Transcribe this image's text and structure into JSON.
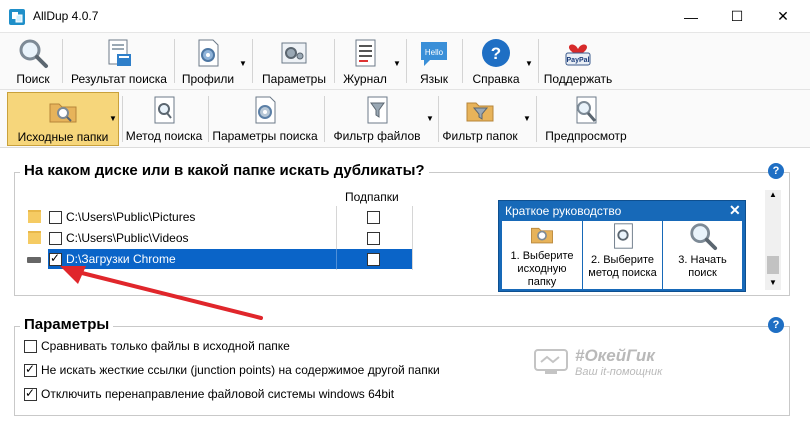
{
  "window": {
    "title": "AllDup 4.0.7",
    "controls": {
      "minimize": "—",
      "maximize": "☐",
      "close": "✕"
    }
  },
  "toolbar1": {
    "items": [
      {
        "label": "Поиск",
        "icon": "magnifier-icon"
      },
      {
        "label": "Результат поиска",
        "icon": "results-icon"
      },
      {
        "label": "Профили",
        "icon": "profiles-icon"
      },
      {
        "label": "Параметры",
        "icon": "settings-icon"
      },
      {
        "label": "Журнал",
        "icon": "log-icon"
      },
      {
        "label": "Язык",
        "icon": "language-icon",
        "badge": "Hello"
      },
      {
        "label": "Справка",
        "icon": "help-icon"
      },
      {
        "label": "Поддержать",
        "icon": "paypal-icon",
        "badge": "PayPal"
      }
    ]
  },
  "toolbar2": {
    "items": [
      {
        "label": "Исходные папки",
        "icon": "source-folders-icon",
        "active": true
      },
      {
        "label": "Метод поиска",
        "icon": "search-method-icon"
      },
      {
        "label": "Параметры поиска",
        "icon": "search-params-icon"
      },
      {
        "label": "Фильтр файлов",
        "icon": "file-filter-icon"
      },
      {
        "label": "Фильтр папок",
        "icon": "folder-filter-icon"
      },
      {
        "label": "Предпросмотр",
        "icon": "preview-icon"
      }
    ]
  },
  "folders_section": {
    "title": "На каком диске или в какой папке искать дубликаты?",
    "col_subfolders": "Подпапки",
    "rows": [
      {
        "path": "C:\\Users\\Public\\Pictures",
        "checked": false,
        "subfolders": false,
        "type": "folder"
      },
      {
        "path": "C:\\Users\\Public\\Videos",
        "checked": false,
        "subfolders": false,
        "type": "folder"
      },
      {
        "path": "D:\\Загрузки Chrome",
        "checked": true,
        "subfolders": false,
        "type": "drive",
        "selected": true
      }
    ]
  },
  "quick_guide": {
    "title": "Краткое руководство",
    "steps": [
      {
        "label": "1. Выберите исходную папку"
      },
      {
        "label": "2. Выберите метод поиска"
      },
      {
        "label": "3. Начать поиск"
      }
    ]
  },
  "params_section": {
    "title": "Параметры",
    "options": [
      {
        "label": "Сравнивать только файлы в исходной папке",
        "checked": false
      },
      {
        "label": "Не искать жесткие ссылки (junction points) на содержимое другой папки",
        "checked": true
      },
      {
        "label": "Отключить перенаправление файловой системы windows 64bit",
        "checked": true
      }
    ]
  },
  "watermark": {
    "brand": "#ОкейГик",
    "tagline": "Ваш it-помощник"
  },
  "help_glyph": "?",
  "colors": {
    "selection": "#0a64c8",
    "guide": "#1769b8",
    "active_tab": "#f6d67b",
    "arrow": "#e0262b"
  }
}
